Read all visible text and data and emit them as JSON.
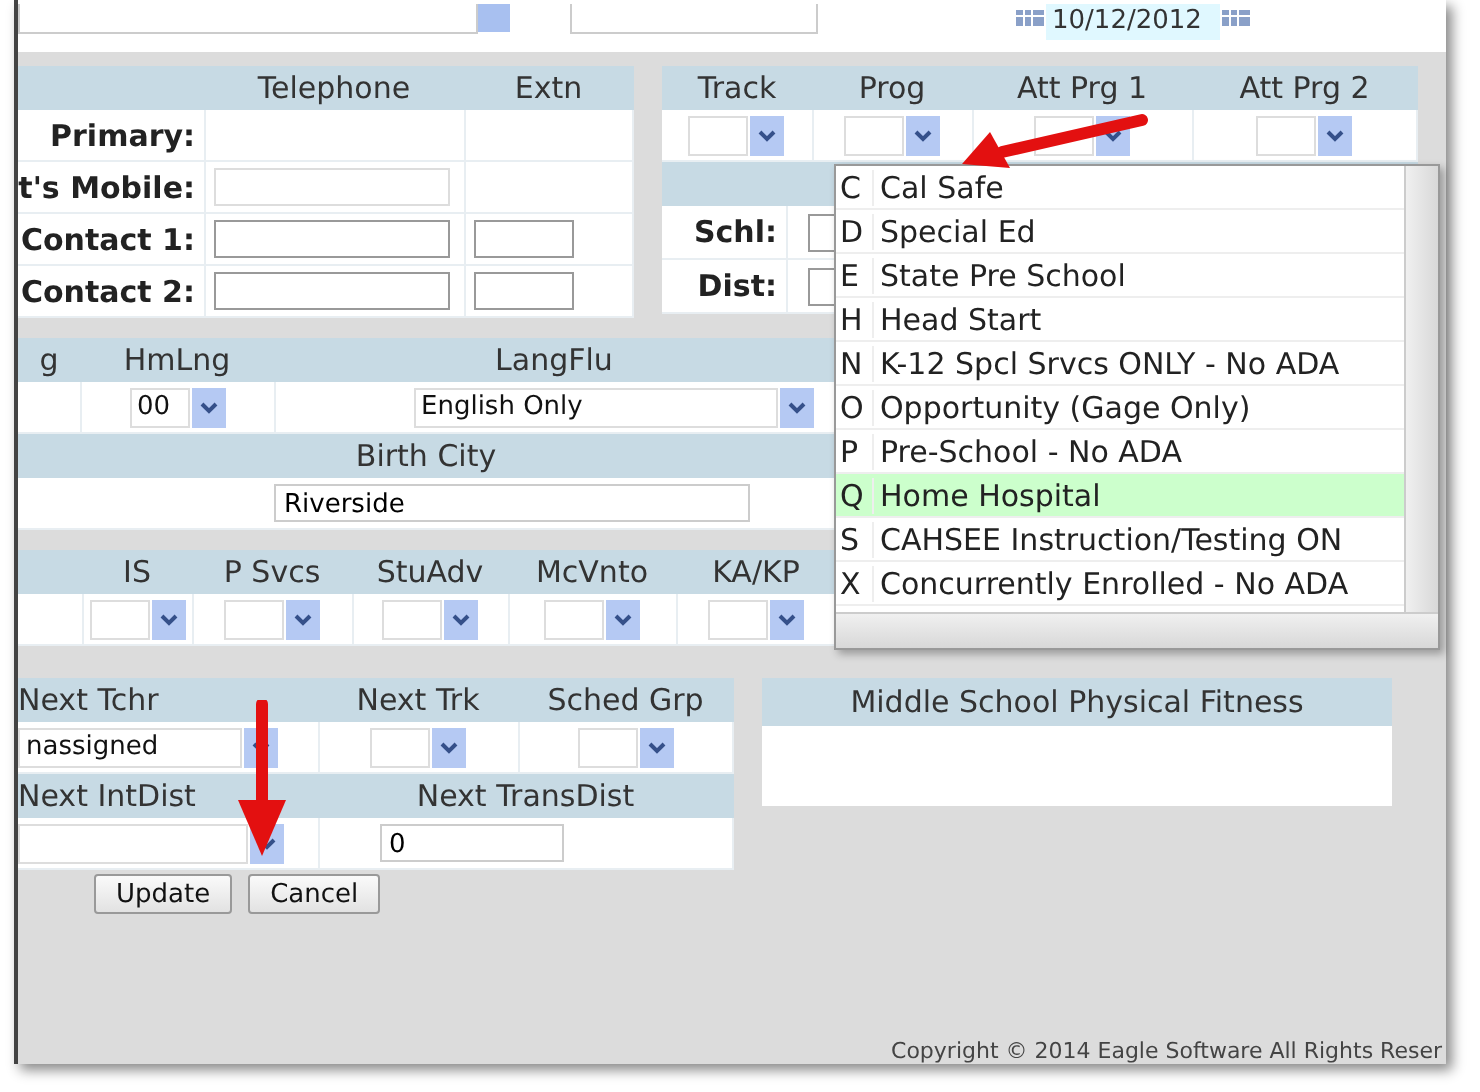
{
  "top_strip": {
    "date": "10/12/2012"
  },
  "phone": {
    "columns": [
      "Telephone",
      "Extn"
    ],
    "rows": [
      {
        "label": "Primary:",
        "kind": "none"
      },
      {
        "label": "t's Mobile:",
        "kind": "phone"
      },
      {
        "label": "Contact 1:",
        "kind": "both"
      },
      {
        "label": "Contact 2:",
        "kind": "both"
      }
    ]
  },
  "enrollment": {
    "columns": [
      "Track",
      "Prog",
      "Att Prg 1",
      "Att Prg 2"
    ],
    "rows": [
      {
        "label": "Schl:"
      },
      {
        "label": "Dist:"
      }
    ]
  },
  "language": {
    "columns": [
      "g",
      "HmLng",
      "LangFlu"
    ],
    "home_language": "00",
    "fluency": "English Only",
    "birth_city_label": "Birth City",
    "birth_city": "Riverside"
  },
  "programs": {
    "columns": [
      "IS",
      "P Svcs",
      "StuAdv",
      "McVnto",
      "KA/KP",
      "",
      "",
      ""
    ]
  },
  "next_year": {
    "columns": [
      "Next Tchr",
      "Next Trk",
      "Sched Grp"
    ],
    "teacher": "nassigned",
    "columns_2": [
      "Next IntDist",
      "Next TransDist"
    ],
    "trans_dist": "0"
  },
  "fitness": {
    "title": "Middle School Physical Fitness"
  },
  "buttons": [
    "Update",
    "Cancel"
  ],
  "dropdown": {
    "items": [
      {
        "code": "C",
        "label": "Cal Safe",
        "selected": false
      },
      {
        "code": "D",
        "label": "Special Ed",
        "selected": false
      },
      {
        "code": "E",
        "label": "State Pre School",
        "selected": false
      },
      {
        "code": "H",
        "label": "Head Start",
        "selected": false
      },
      {
        "code": "N",
        "label": "K-12 Spcl Srvcs ONLY - No ADA",
        "selected": false
      },
      {
        "code": "O",
        "label": "Opportunity (Gage Only)",
        "selected": false
      },
      {
        "code": "P",
        "label": "Pre-School - No ADA",
        "selected": false
      },
      {
        "code": "Q",
        "label": "Home Hospital",
        "selected": true
      },
      {
        "code": "S",
        "label": "CAHSEE Instruction/Testing ON",
        "selected": false
      },
      {
        "code": "X",
        "label": "Concurrently Enrolled - No ADA",
        "selected": false
      }
    ]
  },
  "footer": "Copyright © 2014 Eagle Software All Rights Reser"
}
